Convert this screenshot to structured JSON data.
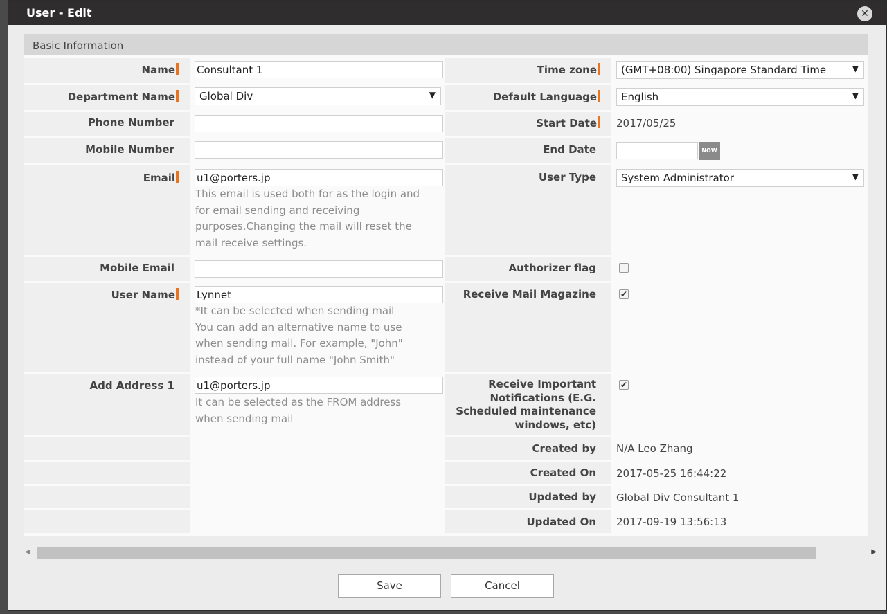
{
  "dialog": {
    "title": "User - Edit",
    "close_label": "✕"
  },
  "section": {
    "title": "Basic Information"
  },
  "left": {
    "name": {
      "label": "Name",
      "value": "Consultant 1"
    },
    "department": {
      "label": "Department Name",
      "value": "Global Div"
    },
    "phone": {
      "label": "Phone Number",
      "value": ""
    },
    "mobile": {
      "label": "Mobile Number",
      "value": ""
    },
    "email": {
      "label": "Email",
      "value": "u1@porters.jp",
      "help_lines": [
        "This email is used both for as the login and",
        "for email sending and receiving",
        "purposes.Changing the mail will reset the",
        "mail receive settings."
      ]
    },
    "mobile_email": {
      "label": "Mobile Email",
      "value": ""
    },
    "user_name": {
      "label": "User Name",
      "value": "Lynnet",
      "help_lines": [
        "*It can be selected when sending mail",
        "You can add an alternative name to use",
        "when sending mail. For example, \"John\"",
        "instead of your full name \"John Smith\""
      ]
    },
    "add_address": {
      "label": "Add Address 1",
      "value": "u1@porters.jp",
      "help_lines": [
        "It can be selected as the FROM address",
        "when sending mail"
      ]
    }
  },
  "right": {
    "timezone": {
      "label": "Time zone",
      "value": "(GMT+08:00) Singapore Standard Time"
    },
    "language": {
      "label": "Default Language",
      "value": "English"
    },
    "start_date": {
      "label": "Start Date",
      "value": "2017/05/25"
    },
    "end_date": {
      "label": "End Date",
      "value": "",
      "now_label": "NOW"
    },
    "user_type": {
      "label": "User Type",
      "value": "System Administrator"
    },
    "authorizer": {
      "label": "Authorizer flag",
      "checked": false
    },
    "mail_magazine": {
      "label": "Receive Mail Magazine",
      "checked": true
    },
    "important": {
      "label_lines": [
        "Receive Important",
        "Notifications (E.G.",
        "Scheduled maintenance",
        "windows, etc)"
      ],
      "checked": true
    },
    "created_by": {
      "label": "Created by",
      "value": "N/A Leo Zhang"
    },
    "created_on": {
      "label": "Created On",
      "value": "2017-05-25 16:44:22"
    },
    "updated_by": {
      "label": "Updated by",
      "value": "Global Div Consultant 1"
    },
    "updated_on": {
      "label": "Updated On",
      "value": "2017-09-19 13:56:13"
    }
  },
  "icons": {
    "dropdown": "▼",
    "check": "✔",
    "scroll_left": "◀",
    "scroll_right": "▶"
  },
  "footer": {
    "save_label": "Save",
    "cancel_label": "Cancel"
  }
}
